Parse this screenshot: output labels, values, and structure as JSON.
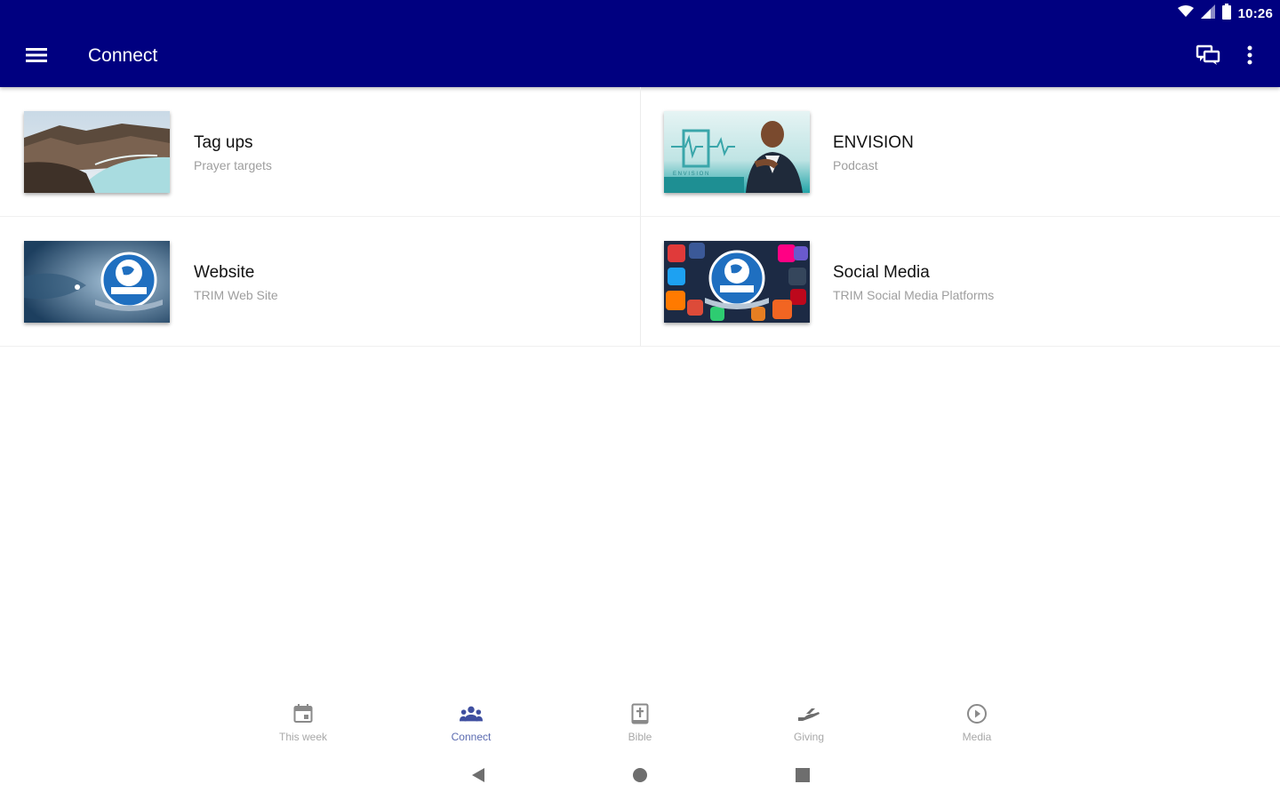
{
  "colors": {
    "appbar": "#000080",
    "accent_nav": "#5b6bb0",
    "muted_text": "#9e9e9e"
  },
  "status_bar": {
    "time": "10:26",
    "icons": [
      "wifi-icon",
      "signal-icon",
      "battery-icon"
    ]
  },
  "toolbar": {
    "title": "Connect",
    "menu_icon": "hamburger-menu-icon",
    "actions": [
      "chat-icon",
      "more-vert-icon"
    ]
  },
  "items": [
    {
      "title": "Tag ups",
      "subtitle": "Prayer targets",
      "thumbnail": "coastal-lake-landscape"
    },
    {
      "title": "ENVISION",
      "subtitle": "Podcast",
      "thumbnail": "envision-podcast-portrait"
    },
    {
      "title": "Website",
      "subtitle": "TRIM Web Site",
      "thumbnail": "trim-globe-logo-blue"
    },
    {
      "title": "Social Media",
      "subtitle": "TRIM Social Media Platforms",
      "thumbnail": "social-media-icons-collage"
    }
  ],
  "bottom_nav": [
    {
      "label": "This week",
      "icon": "calendar-icon",
      "active": false
    },
    {
      "label": "Connect",
      "icon": "group-icon",
      "active": true
    },
    {
      "label": "Bible",
      "icon": "bible-icon",
      "active": false
    },
    {
      "label": "Giving",
      "icon": "giving-hand-icon",
      "active": false
    },
    {
      "label": "Media",
      "icon": "play-circle-icon",
      "active": false
    }
  ],
  "system_nav": [
    "back-icon",
    "home-icon",
    "recents-icon"
  ]
}
